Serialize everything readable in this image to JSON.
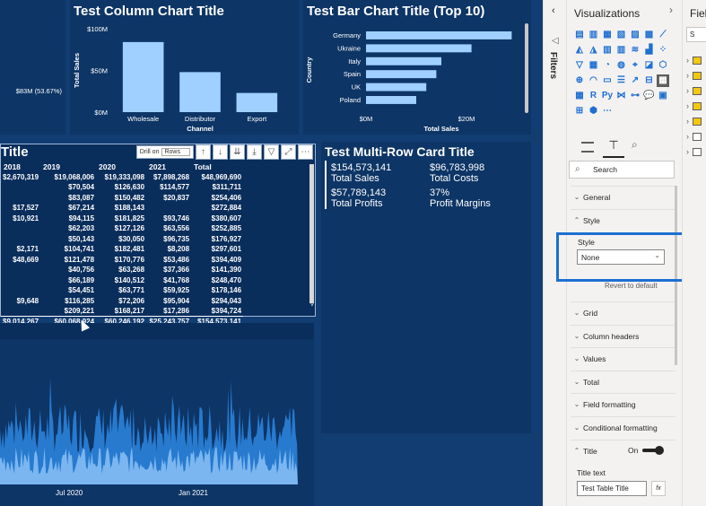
{
  "canvas": {
    "column_chart": {
      "title": "Test Column Chart Title",
      "xlabel": "Channel",
      "ylabel": "Total Sales",
      "yticks": [
        "$100M",
        "$50M",
        "$0M"
      ],
      "categories": [
        "Wholesale",
        "Distributor",
        "Export"
      ]
    },
    "left_fragment_label": "$83M (53.67%)",
    "bar_chart": {
      "title": "Test Bar Chart Title (Top 10)",
      "xlabel": "Total Sales",
      "ylabel": "Country",
      "xticks": [
        "$0M",
        "$20M"
      ],
      "categories": [
        "Germany",
        "Ukraine",
        "Italy",
        "Spain",
        "UK",
        "Poland"
      ]
    },
    "table": {
      "title": "Title",
      "drill_label": "Drill on",
      "drill_value": "Rows",
      "headers": [
        "2018",
        "2019",
        "2020",
        "2021",
        "Total"
      ],
      "rows": [
        [
          "$2,670,319",
          "$19,068,006",
          "$19,333,098",
          "$7,898,268",
          "$48,969,690"
        ],
        [
          "",
          "$70,504",
          "$126,630",
          "$114,577",
          "$311,711"
        ],
        [
          "",
          "$83,087",
          "$150,482",
          "$20,837",
          "$254,406"
        ],
        [
          "$17,527",
          "$67,214",
          "$188,143",
          "",
          "$272,884"
        ],
        [
          "$10,921",
          "$94,115",
          "$181,825",
          "$93,746",
          "$380,607"
        ],
        [
          "",
          "$62,203",
          "$127,126",
          "$63,556",
          "$252,885"
        ],
        [
          "",
          "$50,143",
          "$30,050",
          "$96,735",
          "$176,927"
        ],
        [
          "$2,171",
          "$104,741",
          "$182,481",
          "$8,208",
          "$297,601"
        ],
        [
          "$48,669",
          "$121,478",
          "$170,776",
          "$53,486",
          "$394,409"
        ],
        [
          "",
          "$40,756",
          "$63,268",
          "$37,366",
          "$141,390"
        ],
        [
          "",
          "$66,189",
          "$140,512",
          "$41,768",
          "$248,470"
        ],
        [
          "",
          "$54,451",
          "$63,771",
          "$59,925",
          "$178,146"
        ],
        [
          "$9,648",
          "$116,285",
          "$72,206",
          "$95,904",
          "$294,043"
        ],
        [
          "",
          "$209,221",
          "$168,217",
          "$17,286",
          "$394,724"
        ]
      ],
      "total_row": [
        "$9,014,267",
        "$60,068,924",
        "$60,246,192",
        "$25,243,757",
        "$154,573,141"
      ]
    },
    "multi_row_card": {
      "title": "Test Multi-Row Card Title",
      "cards": [
        {
          "value": "$154,573,141",
          "label": "Total Sales"
        },
        {
          "value": "$96,783,998",
          "label": "Total Costs"
        },
        {
          "value": "$57,789,143",
          "label": "Total Profits"
        },
        {
          "value": "37%",
          "label": "Profit Margins"
        }
      ]
    },
    "area_chart": {
      "xticks": [
        "Jul 2020",
        "Jan 2021"
      ]
    }
  },
  "filters_pane": {
    "label": "Filters"
  },
  "visualizations_pane": {
    "title": "Visualizations",
    "search_placeholder": "Search",
    "sections": [
      {
        "label": "General",
        "state": "collapsed"
      },
      {
        "label": "Style",
        "state": "expanded"
      },
      {
        "label": "Grid",
        "state": "collapsed"
      },
      {
        "label": "Column headers",
        "state": "collapsed"
      },
      {
        "label": "Values",
        "state": "collapsed"
      },
      {
        "label": "Total",
        "state": "collapsed"
      },
      {
        "label": "Field formatting",
        "state": "collapsed"
      },
      {
        "label": "Conditional formatting",
        "state": "collapsed"
      },
      {
        "label": "Title",
        "state": "expanded"
      }
    ],
    "style": {
      "label": "Style",
      "value": "None",
      "revert": "Revert to default"
    },
    "title_toggle": "On",
    "title_text_label": "Title text",
    "title_text_value": "Test Table Title",
    "fx": "fx"
  },
  "fields_pane": {
    "title": "Fiel",
    "search_placeholder": "S"
  },
  "colors": {
    "canvas": "#123d72",
    "bar": "#9fd0ff",
    "highlight": "#1e6fd1"
  },
  "chart_data": [
    {
      "type": "bar",
      "title": "Test Column Chart Title",
      "xlabel": "Channel",
      "ylabel": "Total Sales",
      "categories": [
        "Wholesale",
        "Distributor",
        "Export"
      ],
      "values": [
        84,
        48,
        23
      ],
      "ylim": [
        0,
        100
      ]
    },
    {
      "type": "bar",
      "title": "Test Bar Chart Title (Top 10)",
      "xlabel": "Total Sales",
      "ylabel": "Country",
      "categories": [
        "Germany",
        "Ukraine",
        "Italy",
        "Spain",
        "UK",
        "Poland"
      ],
      "values": [
        29,
        21,
        15,
        14,
        12,
        10
      ],
      "xlim": [
        0,
        30
      ]
    }
  ]
}
